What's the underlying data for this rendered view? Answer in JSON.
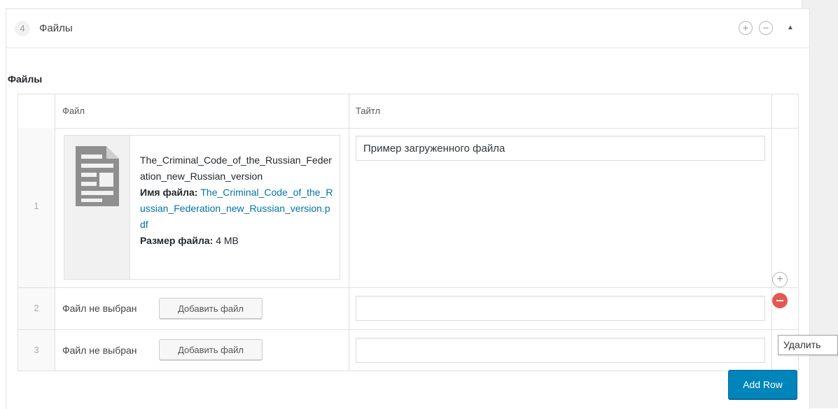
{
  "layout": {
    "order": "4",
    "title": "Файлы"
  },
  "field": {
    "label": "Файлы"
  },
  "table": {
    "headers": {
      "file": "Файл",
      "title": "Тайтл"
    },
    "rows": [
      {
        "num": "1",
        "file": {
          "name": "The_Criminal_Code_of_the_Russian_Federation_new_Russian_version",
          "filename_label": "Имя файла:",
          "filename": "The_Criminal_Code_of_the_Russian_Federation_new_Russian_version.pdf",
          "size_label": "Размер файла:",
          "size": "4 MB"
        },
        "title_value": "Пример загруженного файла"
      },
      {
        "num": "2",
        "no_file_text": "Файл не выбран",
        "add_file_label": "Добавить файл",
        "title_value": ""
      },
      {
        "num": "3",
        "no_file_text": "Файл не выбран",
        "add_file_label": "Добавить файл",
        "title_value": ""
      }
    ]
  },
  "row_actions": {
    "add_symbol": "+",
    "tooltip": "Удалить"
  },
  "header_actions": {
    "plus": "+",
    "minus": "−",
    "toggle": "▲"
  },
  "add_row_label": "Add Row",
  "colors": {
    "primary": "#0085ba",
    "remove": "#e55752",
    "link": "#0073aa"
  }
}
